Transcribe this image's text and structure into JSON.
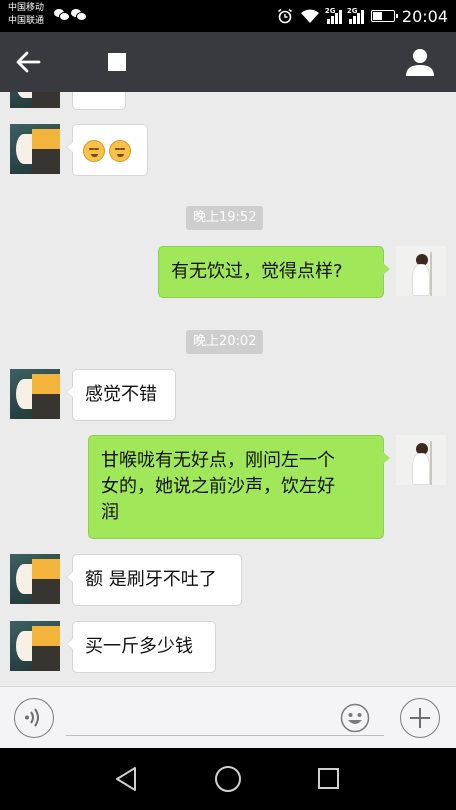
{
  "status_bar": {
    "carrier_1": "中国移动",
    "carrier_2": "中国联通",
    "network_1": "2G",
    "network_2": "2G",
    "time": "20:04"
  },
  "title_bar": {
    "back_icon": "arrow-left-icon",
    "profile_icon": "person-icon"
  },
  "messages": [
    {
      "type": "timestamp",
      "text": "晚上19:52"
    },
    {
      "type": "text",
      "side": "right",
      "text": "有无饮过，觉得点样?"
    },
    {
      "type": "timestamp",
      "text": "晚上20:02"
    },
    {
      "type": "text",
      "side": "left",
      "text": "感觉不错"
    },
    {
      "type": "text",
      "side": "right",
      "lines": [
        "甘喉咙有无好点，刚问左一个",
        "女的，她说之前沙声，饮左好",
        "润"
      ]
    },
    {
      "type": "text",
      "side": "left",
      "text": "额 是刷牙不吐了"
    },
    {
      "type": "text",
      "side": "left",
      "text": "买一斤多少钱"
    }
  ],
  "input_bar": {
    "voice_icon": "voice-icon",
    "emoji_icon": "smiley-icon",
    "more_icon": "plus-icon"
  },
  "nav_bar": {
    "back_icon": "triangle-back-icon",
    "home_icon": "circle-home-icon",
    "recent_icon": "square-recent-icon"
  },
  "colors": {
    "title_bar": "#393a3f",
    "chat_bg": "#ebebeb",
    "outgoing_bubble": "#a0e75a",
    "incoming_bubble": "#ffffff",
    "timestamp_bg": "#cecece"
  }
}
